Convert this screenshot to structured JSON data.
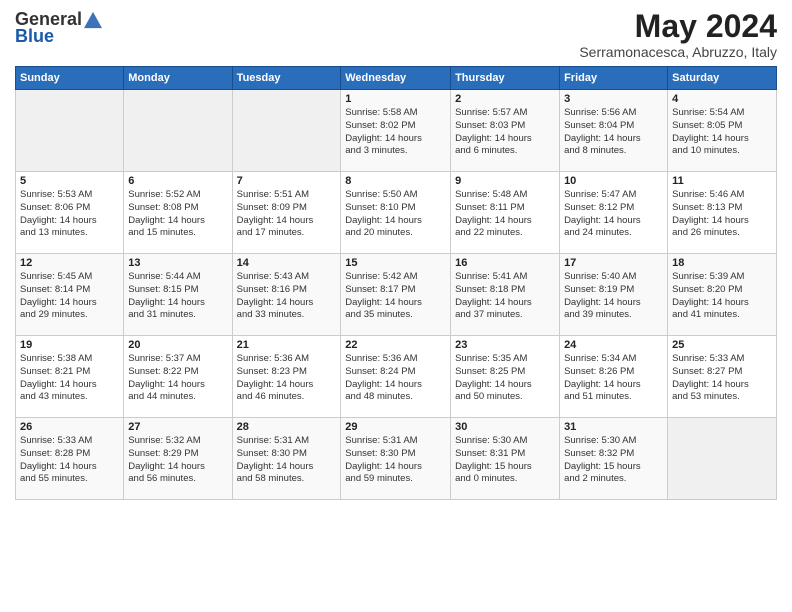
{
  "header": {
    "logo_general": "General",
    "logo_blue": "Blue",
    "month": "May 2024",
    "location": "Serramonacesca, Abruzzo, Italy"
  },
  "weekdays": [
    "Sunday",
    "Monday",
    "Tuesday",
    "Wednesday",
    "Thursday",
    "Friday",
    "Saturday"
  ],
  "weeks": [
    [
      {
        "day": "",
        "info": ""
      },
      {
        "day": "",
        "info": ""
      },
      {
        "day": "",
        "info": ""
      },
      {
        "day": "1",
        "info": "Sunrise: 5:58 AM\nSunset: 8:02 PM\nDaylight: 14 hours\nand 3 minutes."
      },
      {
        "day": "2",
        "info": "Sunrise: 5:57 AM\nSunset: 8:03 PM\nDaylight: 14 hours\nand 6 minutes."
      },
      {
        "day": "3",
        "info": "Sunrise: 5:56 AM\nSunset: 8:04 PM\nDaylight: 14 hours\nand 8 minutes."
      },
      {
        "day": "4",
        "info": "Sunrise: 5:54 AM\nSunset: 8:05 PM\nDaylight: 14 hours\nand 10 minutes."
      }
    ],
    [
      {
        "day": "5",
        "info": "Sunrise: 5:53 AM\nSunset: 8:06 PM\nDaylight: 14 hours\nand 13 minutes."
      },
      {
        "day": "6",
        "info": "Sunrise: 5:52 AM\nSunset: 8:08 PM\nDaylight: 14 hours\nand 15 minutes."
      },
      {
        "day": "7",
        "info": "Sunrise: 5:51 AM\nSunset: 8:09 PM\nDaylight: 14 hours\nand 17 minutes."
      },
      {
        "day": "8",
        "info": "Sunrise: 5:50 AM\nSunset: 8:10 PM\nDaylight: 14 hours\nand 20 minutes."
      },
      {
        "day": "9",
        "info": "Sunrise: 5:48 AM\nSunset: 8:11 PM\nDaylight: 14 hours\nand 22 minutes."
      },
      {
        "day": "10",
        "info": "Sunrise: 5:47 AM\nSunset: 8:12 PM\nDaylight: 14 hours\nand 24 minutes."
      },
      {
        "day": "11",
        "info": "Sunrise: 5:46 AM\nSunset: 8:13 PM\nDaylight: 14 hours\nand 26 minutes."
      }
    ],
    [
      {
        "day": "12",
        "info": "Sunrise: 5:45 AM\nSunset: 8:14 PM\nDaylight: 14 hours\nand 29 minutes."
      },
      {
        "day": "13",
        "info": "Sunrise: 5:44 AM\nSunset: 8:15 PM\nDaylight: 14 hours\nand 31 minutes."
      },
      {
        "day": "14",
        "info": "Sunrise: 5:43 AM\nSunset: 8:16 PM\nDaylight: 14 hours\nand 33 minutes."
      },
      {
        "day": "15",
        "info": "Sunrise: 5:42 AM\nSunset: 8:17 PM\nDaylight: 14 hours\nand 35 minutes."
      },
      {
        "day": "16",
        "info": "Sunrise: 5:41 AM\nSunset: 8:18 PM\nDaylight: 14 hours\nand 37 minutes."
      },
      {
        "day": "17",
        "info": "Sunrise: 5:40 AM\nSunset: 8:19 PM\nDaylight: 14 hours\nand 39 minutes."
      },
      {
        "day": "18",
        "info": "Sunrise: 5:39 AM\nSunset: 8:20 PM\nDaylight: 14 hours\nand 41 minutes."
      }
    ],
    [
      {
        "day": "19",
        "info": "Sunrise: 5:38 AM\nSunset: 8:21 PM\nDaylight: 14 hours\nand 43 minutes."
      },
      {
        "day": "20",
        "info": "Sunrise: 5:37 AM\nSunset: 8:22 PM\nDaylight: 14 hours\nand 44 minutes."
      },
      {
        "day": "21",
        "info": "Sunrise: 5:36 AM\nSunset: 8:23 PM\nDaylight: 14 hours\nand 46 minutes."
      },
      {
        "day": "22",
        "info": "Sunrise: 5:36 AM\nSunset: 8:24 PM\nDaylight: 14 hours\nand 48 minutes."
      },
      {
        "day": "23",
        "info": "Sunrise: 5:35 AM\nSunset: 8:25 PM\nDaylight: 14 hours\nand 50 minutes."
      },
      {
        "day": "24",
        "info": "Sunrise: 5:34 AM\nSunset: 8:26 PM\nDaylight: 14 hours\nand 51 minutes."
      },
      {
        "day": "25",
        "info": "Sunrise: 5:33 AM\nSunset: 8:27 PM\nDaylight: 14 hours\nand 53 minutes."
      }
    ],
    [
      {
        "day": "26",
        "info": "Sunrise: 5:33 AM\nSunset: 8:28 PM\nDaylight: 14 hours\nand 55 minutes."
      },
      {
        "day": "27",
        "info": "Sunrise: 5:32 AM\nSunset: 8:29 PM\nDaylight: 14 hours\nand 56 minutes."
      },
      {
        "day": "28",
        "info": "Sunrise: 5:31 AM\nSunset: 8:30 PM\nDaylight: 14 hours\nand 58 minutes."
      },
      {
        "day": "29",
        "info": "Sunrise: 5:31 AM\nSunset: 8:30 PM\nDaylight: 14 hours\nand 59 minutes."
      },
      {
        "day": "30",
        "info": "Sunrise: 5:30 AM\nSunset: 8:31 PM\nDaylight: 15 hours\nand 0 minutes."
      },
      {
        "day": "31",
        "info": "Sunrise: 5:30 AM\nSunset: 8:32 PM\nDaylight: 15 hours\nand 2 minutes."
      },
      {
        "day": "",
        "info": ""
      }
    ]
  ]
}
